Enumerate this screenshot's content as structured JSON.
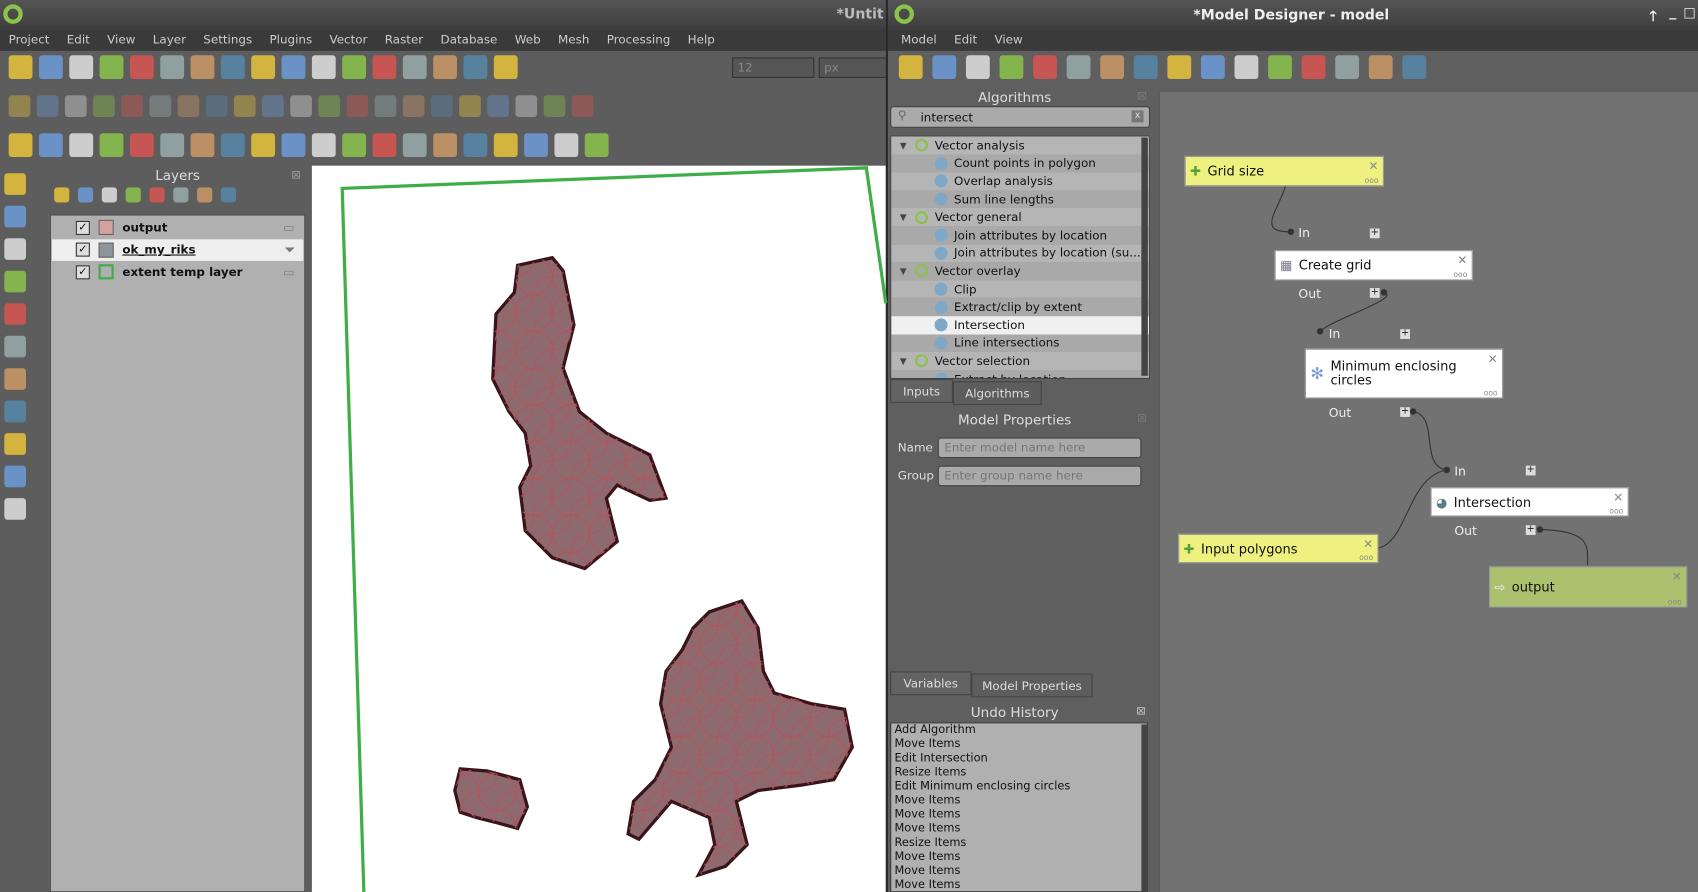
{
  "qgis": {
    "title": "*Untit",
    "menu": [
      "Project",
      "Edit",
      "View",
      "Layer",
      "Settings",
      "Plugins",
      "Vector",
      "Raster",
      "Database",
      "Web",
      "Mesh",
      "Processing",
      "Help"
    ],
    "toolbar1": [
      "new-project-icon",
      "open-project-icon",
      "save-project-icon",
      "save-as-icon",
      "print-layout-icon",
      "style-manager-icon",
      "identify-binoculars-icon",
      "add-layer-icon",
      "new-geopackage-icon",
      "new-vector-icon",
      "digitize-icon",
      "new-temp-layer-icon",
      "new-virtual-layer-icon",
      "python-icon",
      "database-icon",
      "gps-icon",
      "snapping-magnet-icon"
    ],
    "snap_value": "12",
    "snap_unit": "px",
    "toolbar2": [
      "current-edits-icon",
      "toggle-editing-icon",
      "add-feature-icon",
      "vertex-tool-icon",
      "rotate-icon",
      "simplify-icon",
      "add-ring-icon",
      "add-part-icon",
      "fill-ring-icon",
      "delete-ring-icon",
      "delete-part-icon",
      "reshape-icon",
      "offset-curve-icon",
      "split-features-icon",
      "split-parts-icon",
      "merge-features-icon",
      "merge-attributes-icon",
      "rotate-point-icon",
      "label-icon",
      "pencil-icon",
      "attribute-form-icon"
    ],
    "toolbar3": [
      "select-feature-icon",
      "attribute-table-icon",
      "deselect-icon",
      "select-location-icon",
      "pan-hand-icon",
      "pan-to-selection-icon",
      "zoom-in-icon",
      "zoom-out-icon",
      "zoom-full-icon",
      "zoom-selection-icon",
      "zoom-layer-icon",
      "zoom-native-icon",
      "zoom-last-icon",
      "zoom-next-icon",
      "new-map-view-icon",
      "new-3d-view-icon",
      "new-bookmark-icon",
      "show-bookmarks-icon",
      "temporal-controller-icon",
      "refresh-icon"
    ],
    "side_toolbar": [
      "new-vector-icon",
      "add-raster-icon",
      "add-mesh-icon",
      "add-delimited-text-icon",
      "add-gpx-icon",
      "add-spatialite-icon",
      "add-postgis-icon",
      "add-wms-icon",
      "add-wfs-icon",
      "add-wcs-icon",
      "add-arcgis-icon"
    ],
    "layers_title": "Layers",
    "layers_toolbar": [
      "style-icon",
      "add-group-icon",
      "visibility-eye-icon",
      "filter-icon",
      "expression-filter-icon",
      "expand-icon",
      "collapse-icon",
      "remove-layer-icon"
    ],
    "layers": [
      {
        "name": "output",
        "checked": true,
        "swatch": "#d4a0a0"
      },
      {
        "name": "ok_my_riks",
        "checked": true,
        "swatch": "#8e9498",
        "selected": true
      },
      {
        "name": "extent temp layer",
        "checked": true,
        "swatch": "outline-#3fae49"
      }
    ],
    "colors": {
      "polygon_fill": "#8c6a6e",
      "polygon_stroke": "#3a1418",
      "extent": "#3fae49"
    }
  },
  "designer": {
    "title": "*Model Designer - model",
    "menu": [
      "Model",
      "Edit",
      "View"
    ],
    "toolbar": [
      "open-model-icon",
      "save-model-icon",
      "save-as-icon",
      "save-to-project-icon",
      "undo-icon",
      "redo-icon",
      "zoom-in-icon",
      "zoom-out-icon",
      "zoom-actual-icon",
      "zoom-full-icon",
      "export-python-icon",
      "export-image-icon",
      "export-pdf-icon",
      "export-svg-icon",
      "edit-help-icon",
      "run-model-icon"
    ],
    "algorithms_title": "Algorithms",
    "search_value": "intersect",
    "tree": [
      {
        "label": "Vector analysis",
        "type": "cat"
      },
      {
        "label": "Count points in polygon",
        "type": "alg"
      },
      {
        "label": "Overlap analysis",
        "type": "alg"
      },
      {
        "label": "Sum line lengths",
        "type": "alg"
      },
      {
        "label": "Vector general",
        "type": "cat"
      },
      {
        "label": "Join attributes by location",
        "type": "alg"
      },
      {
        "label": "Join attributes by location (su...",
        "type": "alg"
      },
      {
        "label": "Vector overlay",
        "type": "cat"
      },
      {
        "label": "Clip",
        "type": "alg"
      },
      {
        "label": "Extract/clip by extent",
        "type": "alg"
      },
      {
        "label": "Intersection",
        "type": "alg",
        "selected": true
      },
      {
        "label": "Line intersections",
        "type": "alg"
      },
      {
        "label": "Vector selection",
        "type": "cat"
      },
      {
        "label": "Extract by location",
        "type": "alg"
      }
    ],
    "tabs1": [
      "Inputs",
      "Algorithms"
    ],
    "props_title": "Model Properties",
    "name_label": "Name",
    "name_placeholder": "Enter model name here",
    "group_label": "Group",
    "group_placeholder": "Enter group name here",
    "tabs2": [
      "Variables",
      "Model Properties"
    ],
    "undo_title": "Undo History",
    "undo": [
      "Add Algorithm",
      "Move Items",
      "Edit Intersection",
      "Resize Items",
      "Edit Minimum enclosing circles",
      "Move Items",
      "Move Items",
      "Move Items",
      "Resize Items",
      "Move Items",
      "Move Items",
      "Move Items"
    ],
    "nodes": {
      "grid_size": "Grid size",
      "create_grid": "Create grid",
      "min_circles": "Minimum enclosing circles",
      "intersection": "Intersection",
      "input_polygons": "Input polygons",
      "output": "output"
    },
    "port_in": "In",
    "port_out": "Out",
    "colors": {
      "input": "#eef07f",
      "algorithm": "#ffffff",
      "output": "#acc16e",
      "canvas": "#727272"
    }
  }
}
